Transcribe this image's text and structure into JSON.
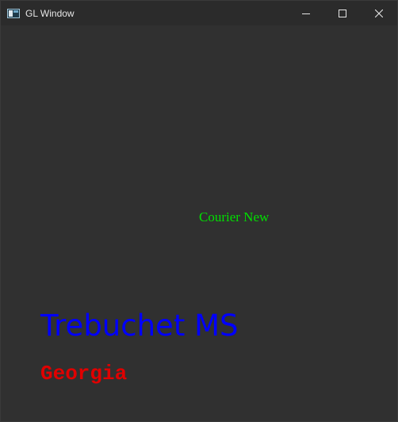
{
  "window": {
    "title": "GL Window",
    "icon": "app-window-icon",
    "controls": {
      "minimize_icon": "minimize-icon",
      "maximize_icon": "maximize-icon",
      "close_icon": "close-icon"
    }
  },
  "canvas": {
    "background": "#303030",
    "labels": [
      {
        "text": "Courier New",
        "color": "#00e000"
      },
      {
        "text": "Trebuchet MS",
        "color": "#0000ff"
      },
      {
        "text": "Georgia",
        "color": "#e00000"
      }
    ]
  }
}
